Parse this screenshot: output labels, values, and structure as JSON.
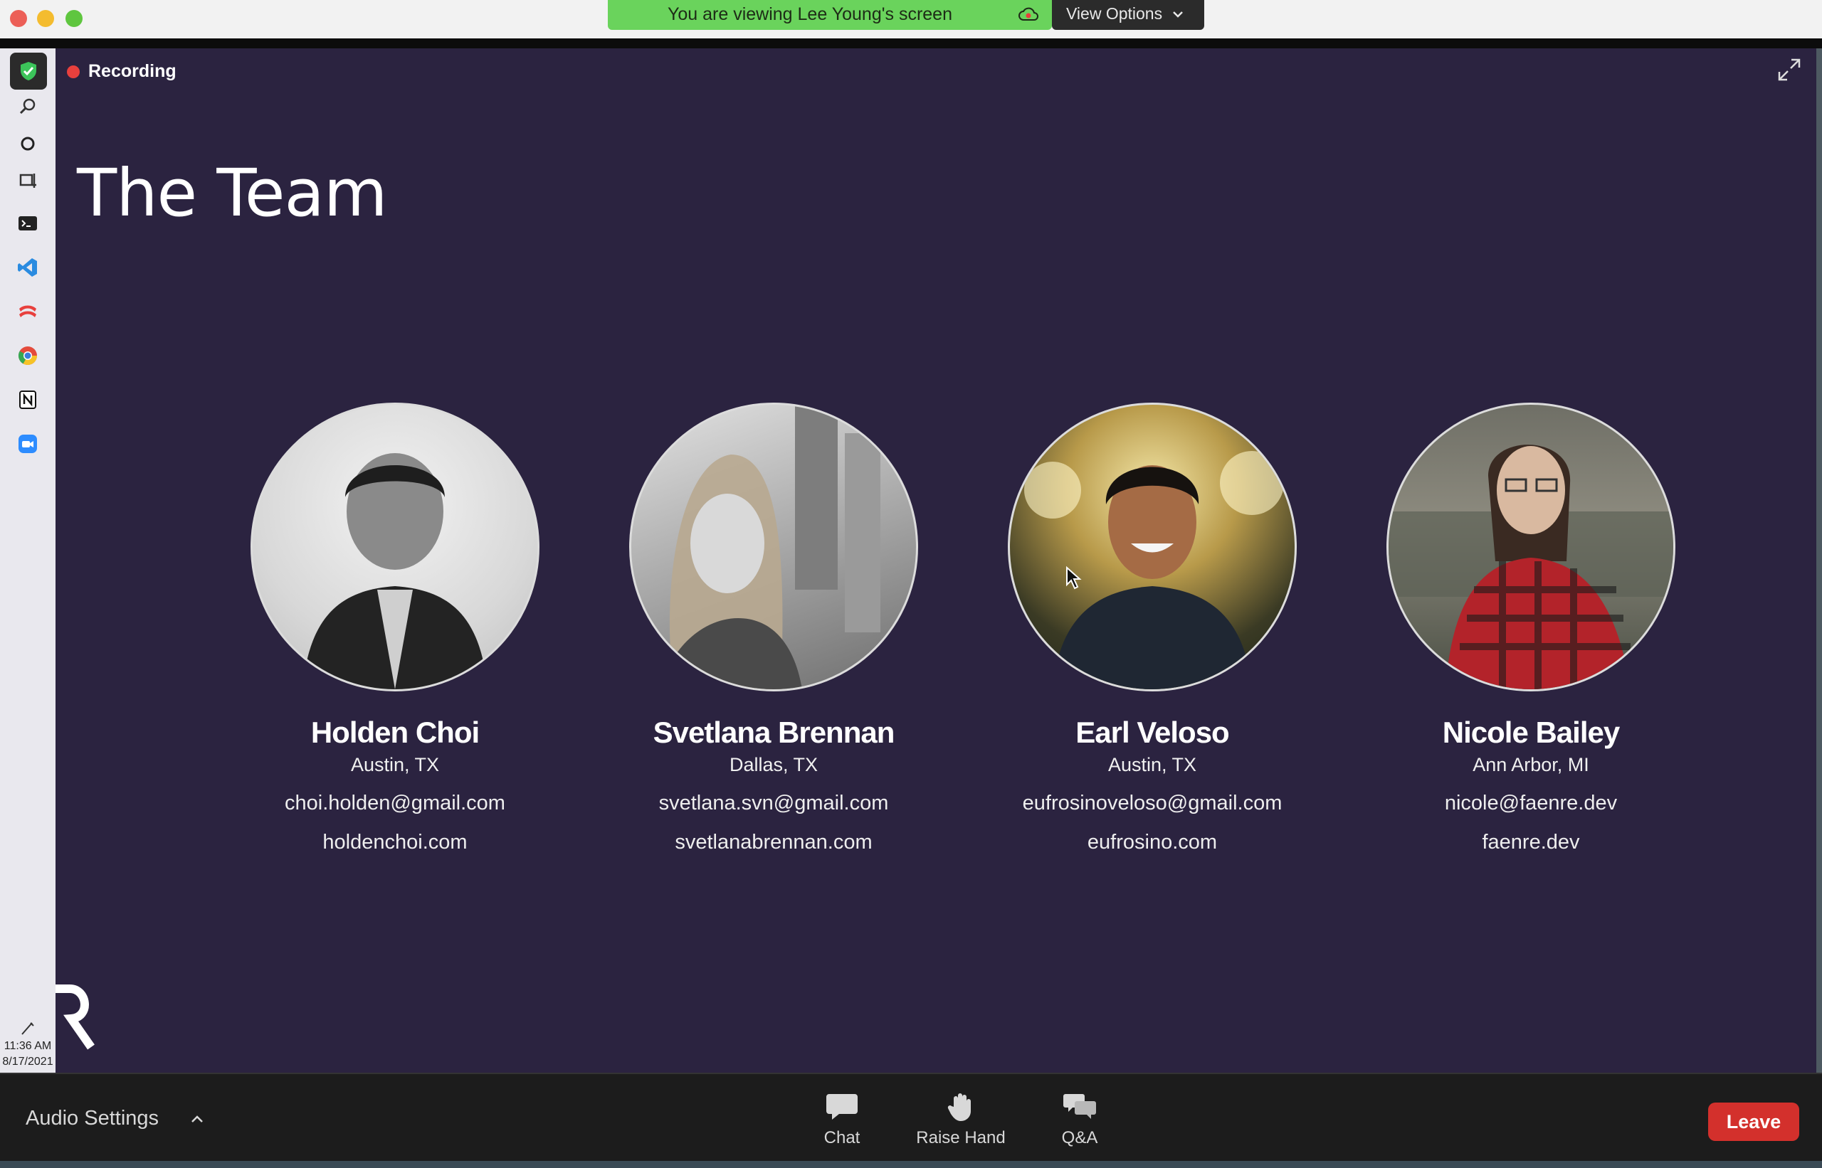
{
  "banner": {
    "viewing_text": "You are viewing Lee Young's screen",
    "view_options_label": "View Options"
  },
  "recording": {
    "label": "Recording"
  },
  "slide": {
    "title": "The Team",
    "members": [
      {
        "name": "Holden Choi",
        "location": "Austin, TX",
        "email": "choi.holden@gmail.com",
        "website": "holdenchoi.com"
      },
      {
        "name": "Svetlana Brennan",
        "location": "Dallas, TX",
        "email": "svetlana.svn@gmail.com",
        "website": "svetlanabrennan.com"
      },
      {
        "name": "Earl Veloso",
        "location": "Austin, TX",
        "email": "eufrosinoveloso@gmail.com",
        "website": "eufrosino.com"
      },
      {
        "name": "Nicole Bailey",
        "location": "Ann Arbor, MI",
        "email": "nicole@faenre.dev",
        "website": "faenre.dev"
      }
    ]
  },
  "dock": {
    "icons": [
      "shield-check-icon",
      "search-icon",
      "circle-icon",
      "screenshot-icon",
      "terminal-icon",
      "vscode-icon",
      "stack-icon",
      "chrome-icon",
      "notion-icon",
      "zoom-icon"
    ],
    "time": "11:36 AM",
    "date": "8/17/2021"
  },
  "toolbar": {
    "audio_settings_label": "Audio Settings",
    "chat_label": "Chat",
    "raise_hand_label": "Raise Hand",
    "qa_label": "Q&A",
    "leave_label": "Leave"
  },
  "colors": {
    "slide_bg": "#2b2340",
    "banner_green": "#6ad35c",
    "leave_red": "#d3302c",
    "recording_red": "#e8403d"
  }
}
